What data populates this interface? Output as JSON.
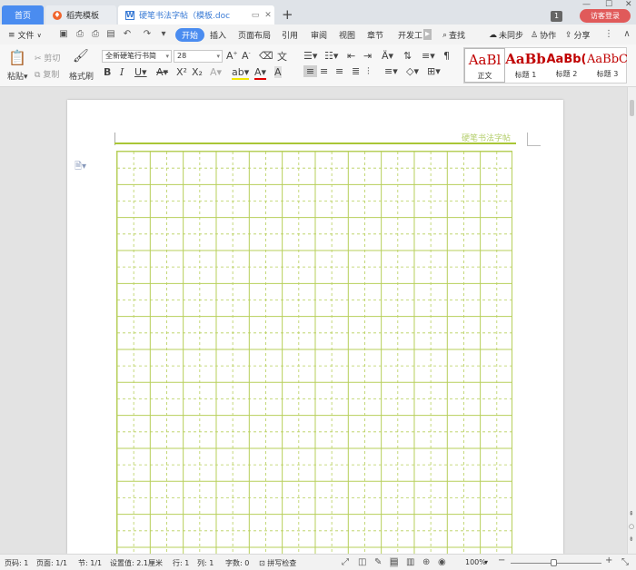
{
  "titlebar": {
    "tabs": [
      {
        "label": "首页"
      },
      {
        "label": "稻壳模板"
      },
      {
        "label": "硬笔书法字帖（模板.doc"
      }
    ],
    "new_tab": "+",
    "counter": "1",
    "login": "访客登录"
  },
  "menu": {
    "file": "文件",
    "items": [
      "开始",
      "插入",
      "页面布局",
      "引用",
      "审阅",
      "视图",
      "章节",
      "开发工"
    ],
    "search": "查找",
    "sync": "未同步",
    "collab": "协作",
    "share": "分享"
  },
  "ribbon": {
    "paste": "粘贴",
    "cut": "剪切",
    "copy": "复制",
    "format_painter": "格式刷",
    "font_name": "全新硬笔行书简",
    "font_size": "28",
    "styles": [
      {
        "preview": "AaBl",
        "label": "正文"
      },
      {
        "preview": "AaBb",
        "label": "标题 1"
      },
      {
        "preview": "AaBb(",
        "label": "标题 2"
      },
      {
        "preview": "AaBbC",
        "label": "标题 3"
      }
    ]
  },
  "document": {
    "header_text": "硬笔书法字帖",
    "grid_color": "#b7cf5a"
  },
  "status": {
    "page_num": "页码: 1",
    "pages": "页面: 1/1",
    "section": "节: 1/1",
    "setting": "设置值: 2.1厘米",
    "row": "行: 1",
    "col": "列: 1",
    "words": "字数: 0",
    "spell": "拼写检查",
    "zoom": "100%"
  }
}
